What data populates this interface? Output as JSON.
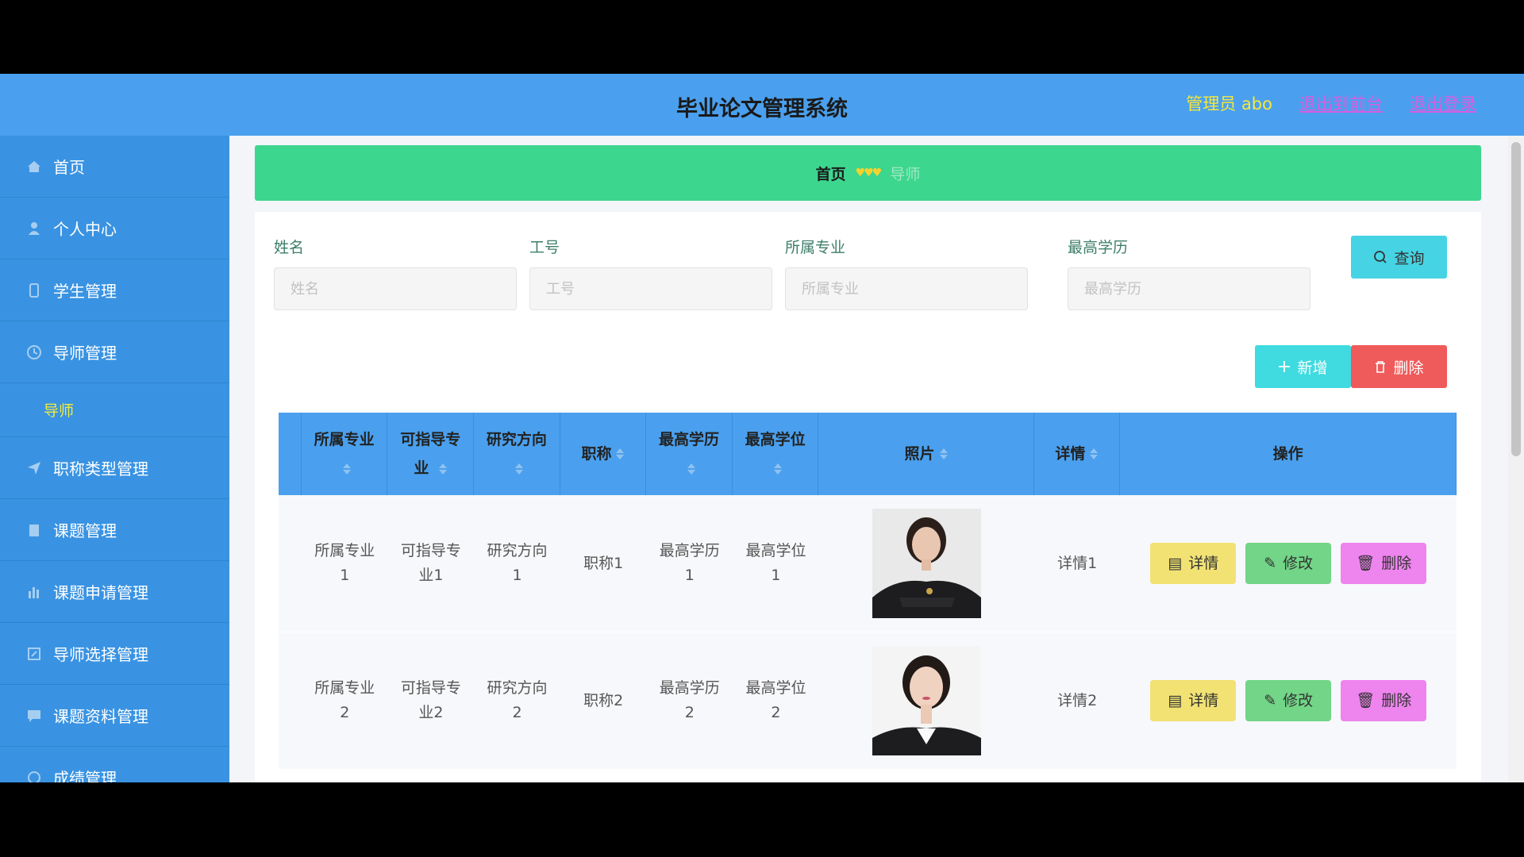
{
  "header": {
    "title": "毕业论文管理系统",
    "admin": "管理员 abo",
    "back_link": "退出到前台",
    "logout_link": "退出登录"
  },
  "sidebar": {
    "items": [
      {
        "label": "首页",
        "icon": "home-icon"
      },
      {
        "label": "个人中心",
        "icon": "user-icon"
      },
      {
        "label": "学生管理",
        "icon": "student-icon"
      },
      {
        "label": "导师管理",
        "icon": "clock-icon"
      }
    ],
    "sub_item": "导师",
    "items_after": [
      {
        "label": "职称类型管理",
        "icon": "send-icon"
      },
      {
        "label": "课题管理",
        "icon": "clipboard-icon"
      },
      {
        "label": "课题申请管理",
        "icon": "chart-icon"
      },
      {
        "label": "导师选择管理",
        "icon": "edit-icon"
      },
      {
        "label": "课题资料管理",
        "icon": "message-icon"
      },
      {
        "label": "成绩管理",
        "icon": "score-icon"
      }
    ]
  },
  "breadcrumb": {
    "home": "首页",
    "current": "导师"
  },
  "search": {
    "fields": [
      {
        "label": "姓名",
        "placeholder": "姓名"
      },
      {
        "label": "工号",
        "placeholder": "工号"
      },
      {
        "label": "所属专业",
        "placeholder": "所属专业"
      },
      {
        "label": "最高学历",
        "placeholder": "最高学历"
      }
    ],
    "query_label": "查询"
  },
  "actions": {
    "add_label": "新增",
    "delete_label": "删除"
  },
  "table": {
    "headers": [
      "所属专业",
      "可指导专业",
      "研究方向",
      "职称",
      "最高学历",
      "最高学位",
      "照片",
      "详情",
      "操作"
    ],
    "rows": [
      {
        "major": "所属专业1",
        "guide": "可指导专业1",
        "research": "研究方向1",
        "title": "职称1",
        "edu": "最高学历1",
        "degree": "最高学位1",
        "detail": "详情1"
      },
      {
        "major": "所属专业2",
        "guide": "可指导专业2",
        "research": "研究方向2",
        "title": "职称2",
        "edu": "最高学历2",
        "degree": "最高学位2",
        "detail": "详情2"
      }
    ],
    "op_detail": "详情",
    "op_edit": "修改",
    "op_delete": "删除"
  },
  "colors": {
    "topbar": "#4aa0ee",
    "sidebar": "#3a93e2",
    "breadcrumb": "#3dd68f",
    "accent_yellow": "#f3ea3c"
  }
}
